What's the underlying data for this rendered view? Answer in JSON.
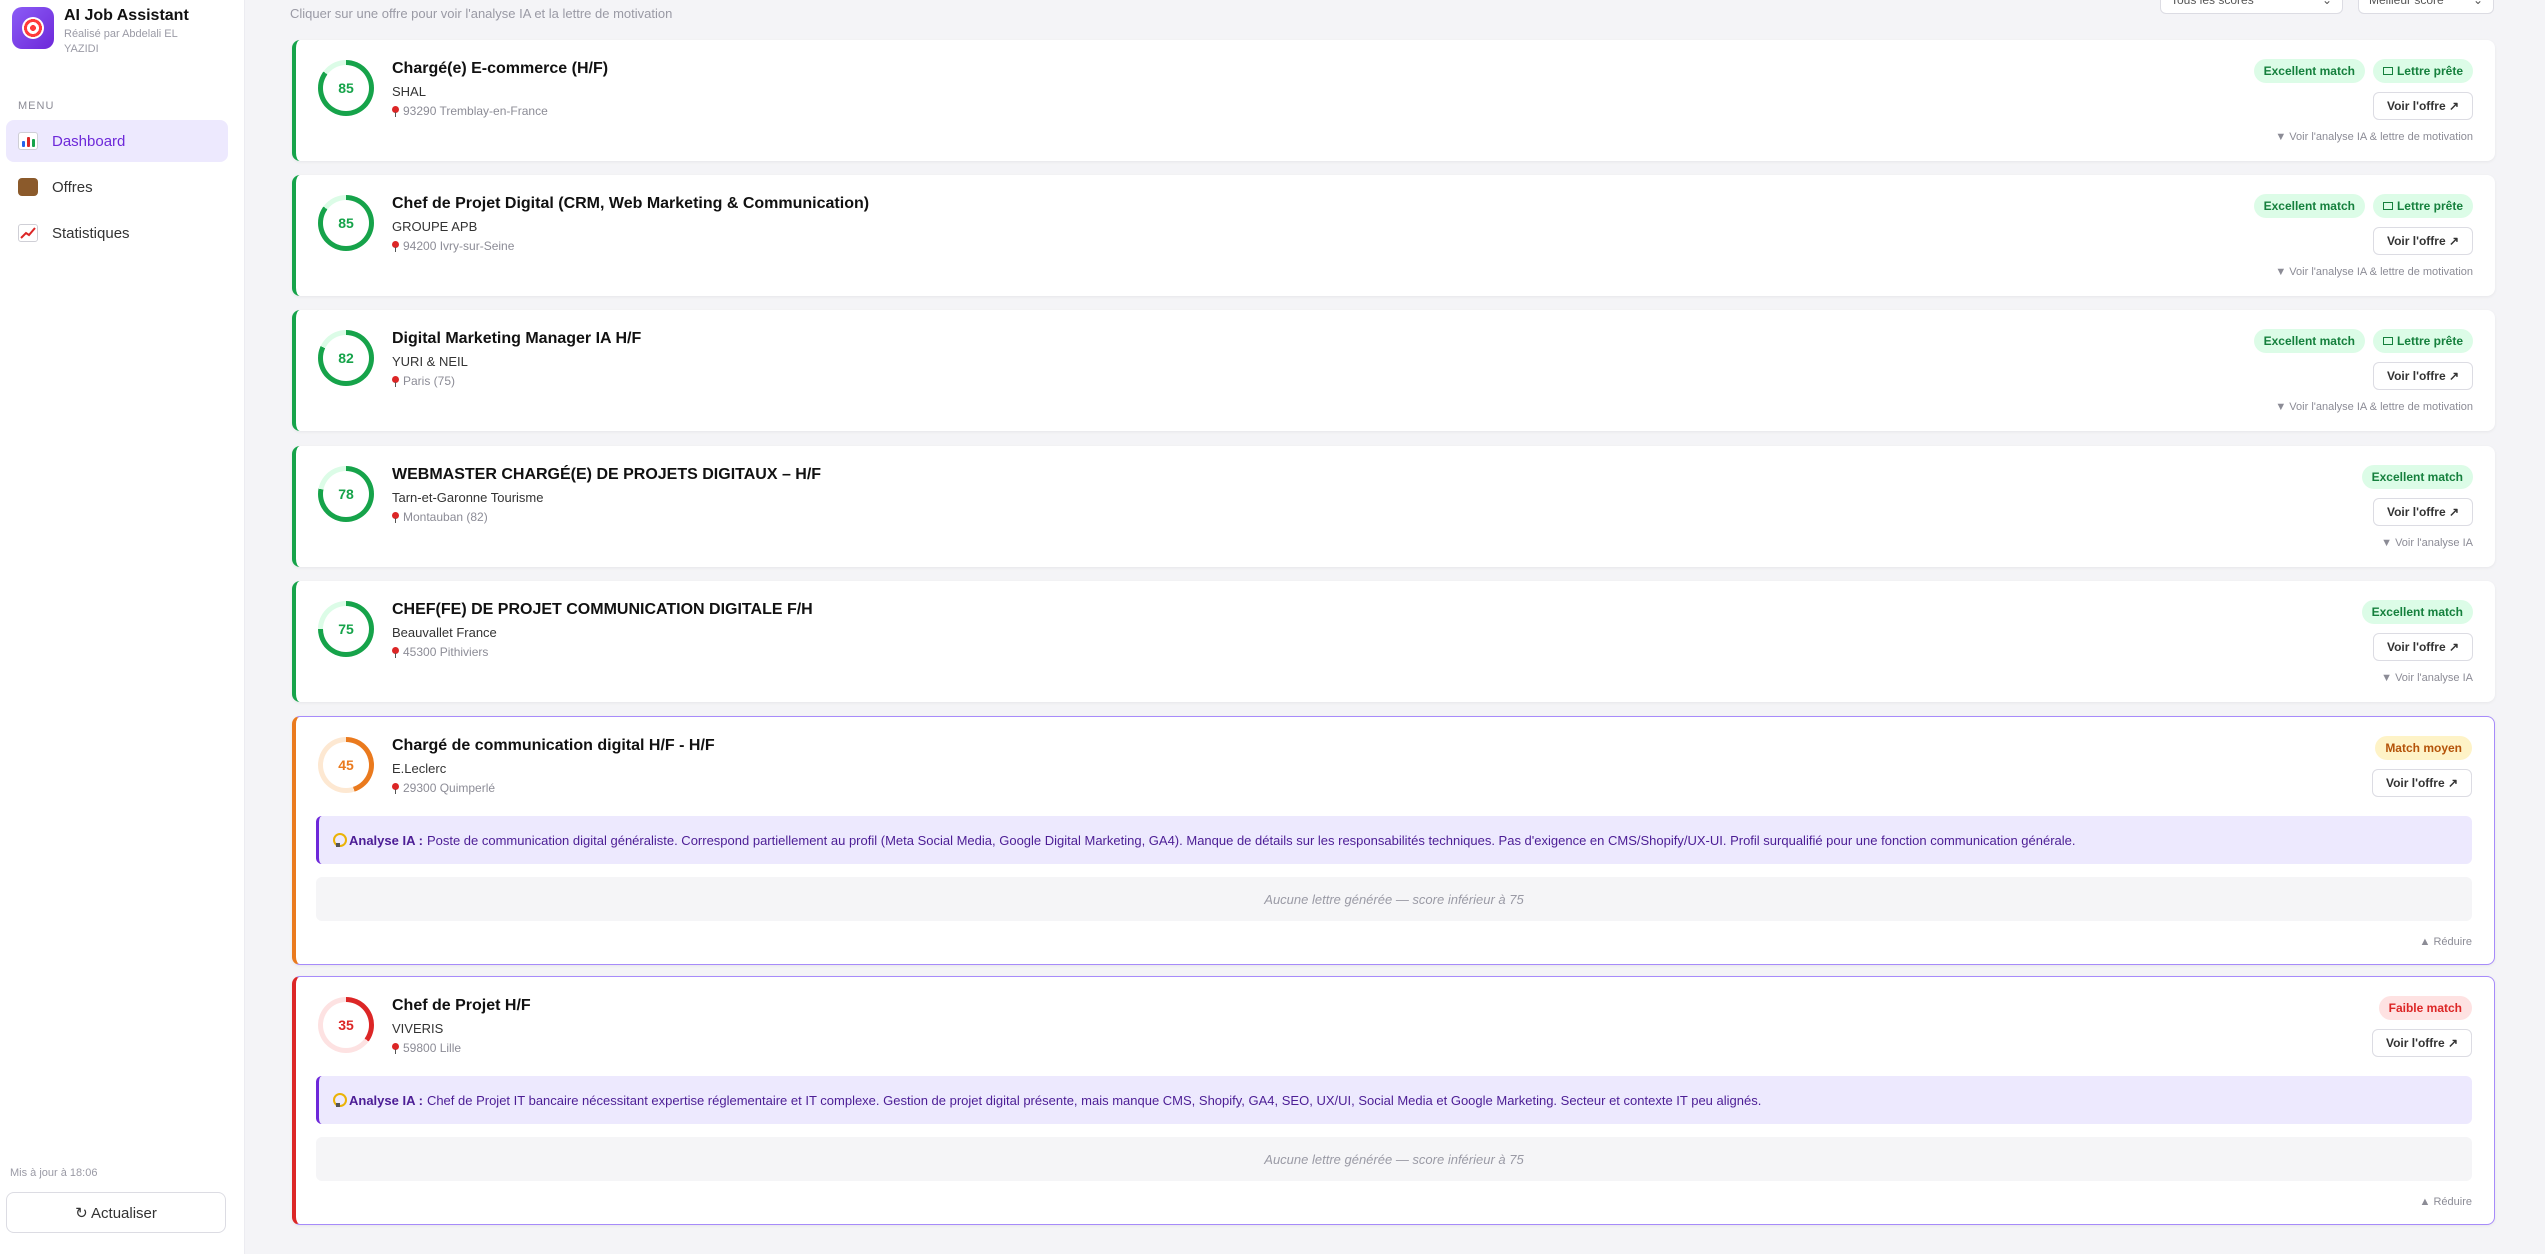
{
  "app": {
    "title": "AI Job Assistant",
    "subtitle": "Réalisé par Abdelali EL YAZIDI"
  },
  "sidebar": {
    "menu_label": "MENU",
    "items": [
      {
        "label": "Dashboard",
        "icon": "chart-icon",
        "active": true
      },
      {
        "label": "Offres",
        "icon": "briefcase-icon",
        "active": false
      },
      {
        "label": "Statistiques",
        "icon": "trend-icon",
        "active": false
      }
    ],
    "updated": "Mis à jour à 18:06",
    "refresh_label": "↻ Actualiser"
  },
  "header": {
    "hint": "Cliquer sur une offre pour voir l'analyse IA et la lettre de motivation",
    "filter_score": "Tous les scores",
    "sort": "Meilleur score"
  },
  "colors": {
    "green": "#16a34a",
    "orange": "#ea7a1e",
    "red": "#dc2626",
    "accent": "#6d28d9"
  },
  "labels": {
    "voir_offre": "Voir l'offre ↗",
    "analyse_prefix": "Analyse IA :",
    "no_letter": "Aucune lettre générée — score inférieur à 75",
    "reduire": "▲ Réduire"
  },
  "offers": [
    {
      "score": 85,
      "title": "Chargé(e) E-commerce (H/F)",
      "company": "SHAL",
      "location": "93290 Tremblay-en-France",
      "match": "Excellent match",
      "letter": "Lettre prête",
      "expand": "▼ Voir l'analyse IA & lettre de motivation"
    },
    {
      "score": 85,
      "title": "Chef de Projet Digital (CRM, Web Marketing & Communication)",
      "company": "GROUPE APB",
      "location": "94200 Ivry-sur-Seine",
      "match": "Excellent match",
      "letter": "Lettre prête",
      "expand": "▼ Voir l'analyse IA & lettre de motivation"
    },
    {
      "score": 82,
      "title": "Digital Marketing Manager IA H/F",
      "company": "YURI & NEIL",
      "location": "Paris (75)",
      "match": "Excellent match",
      "letter": "Lettre prête",
      "expand": "▼ Voir l'analyse IA & lettre de motivation"
    },
    {
      "score": 78,
      "title": "WEBMASTER CHARGÉ(E) DE PROJETS DIGITAUX – H/F",
      "company": "Tarn-et-Garonne Tourisme",
      "location": "Montauban (82)",
      "match": "Excellent match",
      "expand": "▼ Voir l'analyse IA"
    },
    {
      "score": 75,
      "title": "CHEF(FE) DE PROJET COMMUNICATION DIGITALE F/H",
      "company": "Beauvallet France",
      "location": "45300 Pithiviers",
      "match": "Excellent match",
      "expand": "▼ Voir l'analyse IA"
    },
    {
      "score": 45,
      "title": "Chargé de communication digital H/F - H/F",
      "company": "E.Leclerc",
      "location": "29300 Quimperlé",
      "match": "Match moyen",
      "analyse": "Poste de communication digital généraliste. Correspond partiellement au profil (Meta Social Media, Google Digital Marketing, GA4). Manque de détails sur les responsabilités techniques. Pas d'exigence en CMS/Shopify/UX-UI. Profil surqualifié pour une fonction communication générale."
    },
    {
      "score": 35,
      "title": "Chef de Projet H/F",
      "company": "VIVERIS",
      "location": "59800 Lille",
      "match": "Faible match",
      "analyse": "Chef de Projet IT bancaire nécessitant expertise réglementaire et IT complexe. Gestion de projet digital présente, mais manque CMS, Shopify, GA4, SEO, UX/UI, Social Media et Google Marketing. Secteur et contexte IT peu alignés."
    }
  ]
}
